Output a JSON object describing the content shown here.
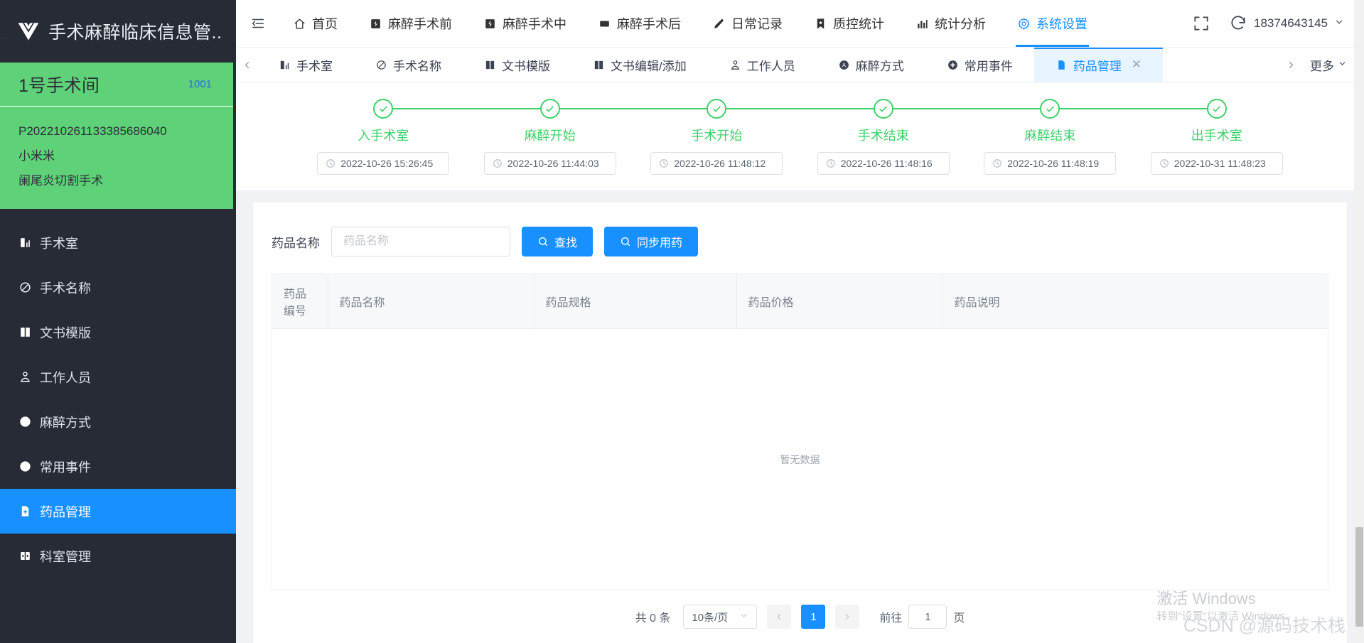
{
  "app": {
    "brand_title": "手术麻醉临床信息管...",
    "logo_icon": "vue-logo-icon"
  },
  "patient": {
    "room_name": "1号手术间",
    "room_no": "1001",
    "patient_id": "P202210261133385686040",
    "patient_name": "小米米",
    "operation_name": "阑尾炎切割手术"
  },
  "sidebar": {
    "items": [
      {
        "label": "手术室",
        "icon": "operating-room-icon",
        "active": false
      },
      {
        "label": "手术名称",
        "icon": "scalpel-icon",
        "active": false
      },
      {
        "label": "文书模版",
        "icon": "book-icon",
        "active": false
      },
      {
        "label": "工作人员",
        "icon": "staff-icon",
        "active": false
      },
      {
        "label": "麻醉方式",
        "icon": "anesthesia-icon",
        "active": false
      },
      {
        "label": "常用事件",
        "icon": "plus-circle-icon",
        "active": false
      },
      {
        "label": "药品管理",
        "icon": "drug-file-icon",
        "active": true
      },
      {
        "label": "科室管理",
        "icon": "department-icon",
        "active": false
      }
    ]
  },
  "topnav": {
    "collapse_icon": "collapse-menu-icon",
    "items": [
      {
        "label": "首页",
        "icon": "home-icon",
        "active": false
      },
      {
        "label": "麻醉手术前",
        "icon": "pre-op-icon",
        "active": false
      },
      {
        "label": "麻醉手术中",
        "icon": "intra-op-icon",
        "active": false
      },
      {
        "label": "麻醉手术后",
        "icon": "post-op-icon",
        "active": false
      },
      {
        "label": "日常记录",
        "icon": "pencil-icon",
        "active": false
      },
      {
        "label": "质控统计",
        "icon": "bookmark-icon",
        "active": false
      },
      {
        "label": "统计分析",
        "icon": "bar-chart-icon",
        "active": false
      },
      {
        "label": "系统设置",
        "icon": "gear-icon",
        "active": true
      }
    ],
    "fullscreen_icon": "fullscreen-icon",
    "user_icon": "user-circle-icon",
    "user_name": "18374643145",
    "user_caret": "chevron-down-icon"
  },
  "tabs": {
    "prev_arrow": "chevron-left-icon",
    "next_arrow": "chevron-right-icon",
    "more_label": "更多",
    "more_caret": "chevron-down-icon",
    "items": [
      {
        "label": "手术室",
        "icon": "operating-room-icon",
        "active": false,
        "closable": false
      },
      {
        "label": "手术名称",
        "icon": "scalpel-icon",
        "active": false,
        "closable": false
      },
      {
        "label": "文书模版",
        "icon": "book-icon",
        "active": false,
        "closable": false
      },
      {
        "label": "文书编辑/添加",
        "icon": "book-icon",
        "active": false,
        "closable": false
      },
      {
        "label": "工作人员",
        "icon": "staff-icon",
        "active": false,
        "closable": false
      },
      {
        "label": "麻醉方式",
        "icon": "anesthesia-icon",
        "active": false,
        "closable": false
      },
      {
        "label": "常用事件",
        "icon": "plus-circle-icon",
        "active": false,
        "closable": false
      },
      {
        "label": "药品管理",
        "icon": "drug-file-icon",
        "active": true,
        "closable": true
      }
    ]
  },
  "steps": {
    "accent_color": "#3ed06a",
    "items": [
      {
        "label": "入手术室",
        "time": "2022-10-26 15:26:45",
        "status": "done"
      },
      {
        "label": "麻醉开始",
        "time": "2022-10-26 11:44:03",
        "status": "done"
      },
      {
        "label": "手术开始",
        "time": "2022-10-26 11:48:12",
        "status": "done"
      },
      {
        "label": "手术结束",
        "time": "2022-10-26 11:48:16",
        "status": "done"
      },
      {
        "label": "麻醉结束",
        "time": "2022-10-26 11:48:19",
        "status": "done"
      },
      {
        "label": "出手术室",
        "time": "2022-10-31 11:48:23",
        "status": "done"
      }
    ]
  },
  "filter": {
    "label": "药品名称",
    "input_value": "",
    "input_placeholder": "药品名称",
    "search_button": "查找",
    "search_icon": "search-icon",
    "sync_button": "同步用药",
    "sync_icon": "search-icon"
  },
  "table": {
    "columns": [
      "药品编号",
      "药品名称",
      "药品规格",
      "药品价格",
      "药品说明"
    ],
    "rows": [],
    "empty_text": "暂无数据"
  },
  "pagination": {
    "total_text": "共 0 条",
    "page_size": "10条/页",
    "page_size_caret": "chevron-down-icon",
    "prev_icon": "chevron-left-icon",
    "next_icon": "chevron-right-icon",
    "current_page": "1",
    "jump_label": "前往",
    "jump_value": "1",
    "jump_unit": "页"
  },
  "watermark": {
    "activate_title": "激活 Windows",
    "activate_sub": "转到\"设置\"以激活 Windows。",
    "csdn": "CSDN @源码技术栈"
  },
  "colors": {
    "primary": "#1890ff",
    "sidebar_bg": "#262b36",
    "patient_green": "#5fd178",
    "step_green": "#3ed06a"
  }
}
